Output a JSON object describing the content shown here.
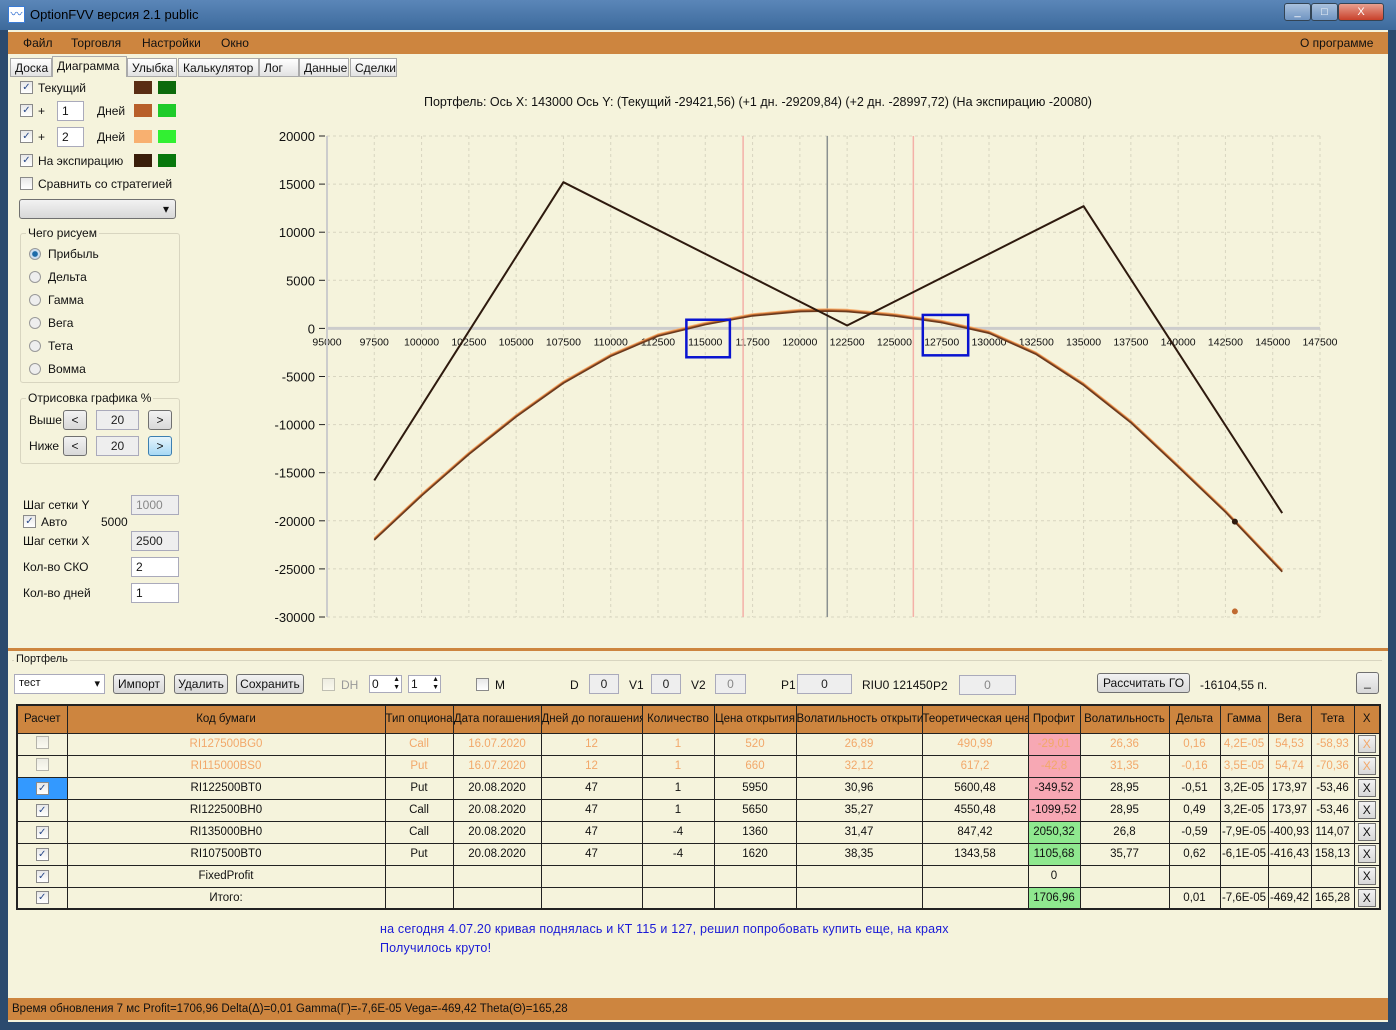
{
  "window": {
    "title": "OptionFVV версия 2.1 public",
    "minimize": "_",
    "maximize": "□",
    "close": "X"
  },
  "menu": {
    "items": [
      "Файл",
      "Торговля",
      "Настройки",
      "Окно"
    ],
    "about": "О программе"
  },
  "tabs": [
    "Доска",
    "Диаграмма",
    "Улыбка",
    "Калькулятор",
    "Лог",
    "Данные",
    "Сделки"
  ],
  "active_tab": "Диаграмма",
  "left": {
    "curves": [
      {
        "label": "Текущий",
        "checked": true,
        "color1": "#5a2d14",
        "color2": "#0c6a0c"
      },
      {
        "label": "+",
        "days": "1",
        "days_label": "Дней",
        "checked": true,
        "color1": "#b85f2a",
        "color2": "#1ecb2a"
      },
      {
        "label": "+",
        "days": "2",
        "days_label": "Дней",
        "checked": true,
        "color1": "#f8b070",
        "color2": "#32f032"
      },
      {
        "label": "На экспирацию",
        "checked": true,
        "color1": "#3a1e0a",
        "color2": "#08780c"
      }
    ],
    "compare": {
      "label": "Сравнить со стратегией",
      "checked": false
    },
    "strategy_select": "",
    "draw_group": {
      "title": "Чего рисуем",
      "options": [
        "Прибыль",
        "Дельта",
        "Гамма",
        "Вега",
        "Тета",
        "Вомма"
      ],
      "selected": "Прибыль"
    },
    "range_group": {
      "title": "Отрисовка графика %",
      "above_label": "Выше",
      "above": "20",
      "below_label": "Ниже",
      "below": "20",
      "prev": "<",
      "next": ">"
    },
    "grid_y_label": "Шаг сетки Y",
    "grid_y": "1000",
    "auto_label": "Авто",
    "auto_checked": true,
    "auto_value": "5000",
    "grid_x_label": "Шаг сетки X",
    "grid_x": "2500",
    "sko_label": "Кол-во СКО",
    "sko": "2",
    "days_label": "Кол-во дней",
    "days": "1"
  },
  "chart_data": {
    "type": "line",
    "title": "Портфель: Ось X:  143000 Ось Y:  (Текущий -29421,56)  (+1 дн. -29209,84)  (+2 дн. -28997,72)  (На экспирацию -20080)",
    "xlim": [
      95000,
      147500
    ],
    "ylim": [
      -30000,
      20000
    ],
    "x_ticks": [
      95000,
      97500,
      100000,
      102500,
      105000,
      107500,
      110000,
      112500,
      115000,
      117500,
      120000,
      122500,
      125000,
      127500,
      130000,
      132500,
      135000,
      137500,
      140000,
      142500,
      145000,
      147500
    ],
    "y_ticks": [
      20000,
      15000,
      10000,
      5000,
      0,
      -5000,
      -10000,
      -15000,
      -20000,
      -25000,
      -30000
    ],
    "grid": true,
    "series": [
      {
        "name": "На экспирацию",
        "color": "#2e1a0e",
        "x": [
          97500,
          107500,
          122500,
          135000,
          145500
        ],
        "y": [
          -15800,
          15200,
          300,
          12700,
          -19200
        ]
      },
      {
        "name": "Текущий",
        "color": "#6b3a1e",
        "x": [
          97500,
          100000,
          102500,
          105000,
          107500,
          110000,
          112500,
          115000,
          117500,
          120000,
          121500,
          122500,
          125000,
          127500,
          130000,
          132500,
          135000,
          137500,
          140000,
          142500,
          145500
        ],
        "y": [
          -22000,
          -17400,
          -13100,
          -9200,
          -5700,
          -2900,
          -800,
          400,
          1300,
          1750,
          1800,
          1750,
          1300,
          600,
          -500,
          -2700,
          -5900,
          -9800,
          -14400,
          -19100,
          -25300
        ]
      },
      {
        "name": "+1 дн.",
        "color": "#c06a30",
        "x": [
          97500,
          100000,
          102500,
          105000,
          107500,
          110000,
          112500,
          115000,
          117500,
          120000,
          121500,
          122500,
          125000,
          127500,
          130000,
          132500,
          135000,
          137500,
          140000,
          142500,
          145500
        ],
        "y": [
          -21900,
          -17300,
          -13000,
          -9100,
          -5600,
          -2800,
          -700,
          500,
          1400,
          1850,
          1900,
          1850,
          1400,
          700,
          -400,
          -2600,
          -5800,
          -9700,
          -14300,
          -19000,
          -25200
        ]
      },
      {
        "name": "+2 дн.",
        "color": "#f8b070",
        "x": [
          97500,
          100000,
          102500,
          105000,
          107500,
          110000,
          112500,
          115000,
          117500,
          120000,
          121500,
          122500,
          125000,
          127500,
          130000,
          132500,
          135000,
          137500,
          140000,
          142500,
          145500
        ],
        "y": [
          -21800,
          -17200,
          -12900,
          -9000,
          -5500,
          -2700,
          -600,
          600,
          1500,
          1950,
          2000,
          1950,
          1500,
          800,
          -300,
          -2500,
          -5700,
          -9600,
          -14200,
          -18900,
          -25100
        ]
      }
    ],
    "markers": [
      {
        "x": 143000,
        "y": -20080,
        "color": "#2e1a0e"
      },
      {
        "x": 143000,
        "y": -29421.56,
        "color": "#c06a30"
      }
    ],
    "vlines": [
      {
        "x": 117000,
        "color": "#f4b0a8"
      },
      {
        "x": 121450,
        "color": "#8a9090"
      },
      {
        "x": 126000,
        "color": "#f4b0a8"
      }
    ],
    "highlight_boxes": [
      {
        "x0": 114000,
        "x1": 116300,
        "y0": -3000,
        "y1": 900
      },
      {
        "x0": 126500,
        "x1": 128900,
        "y0": -2800,
        "y1": 1400
      }
    ]
  },
  "portfolio": {
    "title": "Портфель",
    "name": "тест",
    "import": "Импорт",
    "delete": "Удалить",
    "save": "Сохранить",
    "dh_label": "DH",
    "spin1": "0",
    "spin2": "1",
    "m_label": "M",
    "d_label": "D",
    "d": "0",
    "v1_label": "V1",
    "v1": "0",
    "v2_label": "V2",
    "v2": "0",
    "p1_label": "P1",
    "p1": "0",
    "underlying": "RIU0 121450",
    "p2_label": "P2",
    "p2": "0",
    "calc_go": "Рассчитать ГО",
    "go_value": "-16104,55 п.",
    "collapse": "_",
    "columns": [
      "Расчет",
      "Код бумаги",
      "Тип опциона",
      "Дата погашения",
      "Дней до погашения",
      "Количество",
      "Цена открытия",
      "Волатильность открытия",
      "Теоретическая цена",
      "Профит",
      "Волатильность",
      "Дельта",
      "Гамма",
      "Вега",
      "Тета",
      "X"
    ],
    "rows": [
      {
        "checked": false,
        "faded": true,
        "cells": [
          "RI127500BG0",
          "Call",
          "16.07.2020",
          "12",
          "1",
          "520",
          "26,89",
          "490,99",
          "-29,01",
          "26,36",
          "0,16",
          "4,2E-05",
          "54,53",
          "-58,93"
        ],
        "profit_state": "neg"
      },
      {
        "checked": false,
        "faded": true,
        "cells": [
          "RI115000BS0",
          "Put",
          "16.07.2020",
          "12",
          "1",
          "660",
          "32,12",
          "617,2",
          "-42,8",
          "31,35",
          "-0,16",
          "3,5E-05",
          "54,74",
          "-70,36"
        ],
        "profit_state": "neg"
      },
      {
        "checked": true,
        "selected": true,
        "cells": [
          "RI122500BT0",
          "Put",
          "20.08.2020",
          "47",
          "1",
          "5950",
          "30,96",
          "5600,48",
          "-349,52",
          "28,95",
          "-0,51",
          "3,2E-05",
          "173,97",
          "-53,46"
        ],
        "profit_state": "neg"
      },
      {
        "checked": true,
        "cells": [
          "RI122500BH0",
          "Call",
          "20.08.2020",
          "47",
          "1",
          "5650",
          "35,27",
          "4550,48",
          "-1099,52",
          "28,95",
          "0,49",
          "3,2E-05",
          "173,97",
          "-53,46"
        ],
        "profit_state": "neg"
      },
      {
        "checked": true,
        "cells": [
          "RI135000BH0",
          "Call",
          "20.08.2020",
          "47",
          "-4",
          "1360",
          "31,47",
          "847,42",
          "2050,32",
          "26,8",
          "-0,59",
          "-7,9E-05",
          "-400,93",
          "114,07"
        ],
        "profit_state": "pos"
      },
      {
        "checked": true,
        "cells": [
          "RI107500BT0",
          "Put",
          "20.08.2020",
          "47",
          "-4",
          "1620",
          "38,35",
          "1343,58",
          "1105,68",
          "35,77",
          "0,62",
          "-6,1E-05",
          "-416,43",
          "158,13"
        ],
        "profit_state": "pos"
      },
      {
        "checked": true,
        "cells": [
          "FixedProfit",
          "",
          "",
          "",
          "",
          "",
          "",
          "",
          "0",
          "",
          "",
          "",
          "",
          ""
        ],
        "profit_state": ""
      },
      {
        "checked": true,
        "cells": [
          "Итого:",
          "",
          "",
          "",
          "",
          "",
          "",
          "",
          "1706,96",
          "",
          "0,01",
          "-7,6E-05",
          "-469,42",
          "165,28"
        ],
        "profit_state": "pos"
      }
    ],
    "remove": "X"
  },
  "note": [
    "на сегодня 4.07.20 кривая поднялась и КТ 115 и 127, решил попробовать купить еще, на краях",
    "Получилось круто!"
  ],
  "status": "Время обновления 7 мс  Profit=1706,96 Delta(Δ)=0,01 Gamma(Γ)=-7,6E-05 Vega=-469,42 Theta(Θ)=165,28"
}
